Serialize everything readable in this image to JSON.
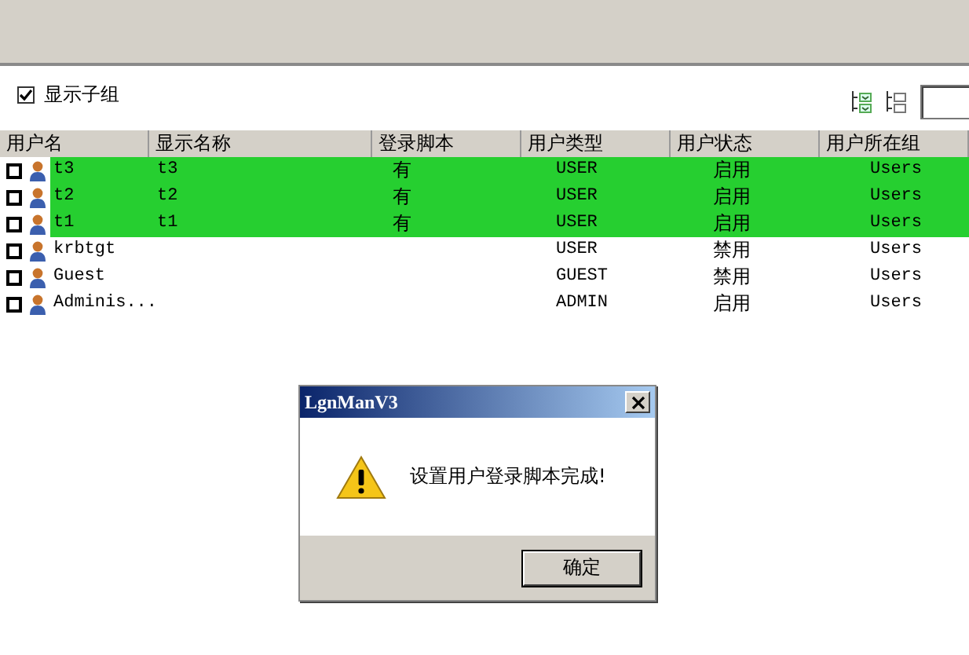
{
  "show_subgroups": {
    "label": "显示子组",
    "checked": true
  },
  "table": {
    "columns": [
      "用户名",
      "显示名称",
      "登录脚本",
      "用户类型",
      "用户状态",
      "用户所在组"
    ],
    "rows": [
      {
        "checked": false,
        "selected": true,
        "cells": [
          "t3",
          "t3",
          "有",
          "USER",
          "启用",
          "Users"
        ]
      },
      {
        "checked": false,
        "selected": true,
        "cells": [
          "t2",
          "t2",
          "有",
          "USER",
          "启用",
          "Users"
        ]
      },
      {
        "checked": false,
        "selected": true,
        "cells": [
          "t1",
          "t1",
          "有",
          "USER",
          "启用",
          "Users"
        ]
      },
      {
        "checked": false,
        "selected": false,
        "cells": [
          "krbtgt",
          "",
          "",
          "USER",
          "禁用",
          "Users"
        ]
      },
      {
        "checked": false,
        "selected": false,
        "cells": [
          "Guest",
          "",
          "",
          "GUEST",
          "禁用",
          "Users"
        ]
      },
      {
        "checked": false,
        "selected": false,
        "cells": [
          "Adminis...",
          "",
          "",
          "ADMIN",
          "启用",
          "Users"
        ]
      }
    ]
  },
  "dialog": {
    "title": "LgnManV3",
    "message": "设置用户登录脚本完成!",
    "button": "确定"
  }
}
